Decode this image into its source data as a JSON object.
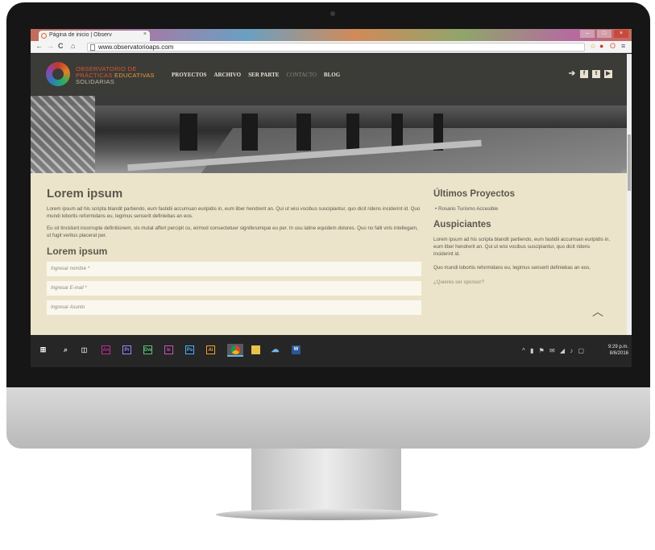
{
  "browser": {
    "tab_title": "Página de inicio | Observ",
    "tab_close": "×",
    "url": "www.observatorioaps.com",
    "back": "←",
    "forward": "→",
    "reload": "C",
    "home": "⌂",
    "star": "☆",
    "menu": "≡"
  },
  "site": {
    "logo": {
      "line1": "OBSERVATORIO DE",
      "line2a": "PRÁCTICAS ",
      "line2b": "EDUCATIVAS",
      "line3": "SOLIDARIAS"
    },
    "nav": [
      "PROYECTOS",
      "ARCHIVO",
      "SER PARTE",
      "CONTACTO",
      "BLOG"
    ],
    "social_icons": [
      "login-icon",
      "facebook-icon",
      "twitter-icon",
      "youtube-icon"
    ],
    "main": {
      "heading": "Lorem ipsum",
      "paragraph1": "Lorem ipsum ad his scripta blandit partiendo, eum fastidii accumsan euripidis in, eum liber hendrerit an. Qui ut wisi vocibus suscipiantur, quo dicit ridens inciderint id. Quo mundi lobortis reformidans eu, legimus senserit definiebas an eos.",
      "paragraph2": "Eu sit tincidunt incorrupte definitionem, vis mutat affert percipit cu, eirmod consectetuer signiferumque eu per. In usu latine equidem dolores. Quo no falli viris intellegam, ut fugit veritus placerat per.",
      "subheading": "Lorem ipsum",
      "placeholders": {
        "name": "Ingresar nombre *",
        "email": "Ingresar E-mail *",
        "subject": "Ingresar Asunto"
      }
    },
    "sidebar": {
      "heading1": "Últimos Proyectos",
      "project": "Rosario Turismo Accesible",
      "heading2": "Auspiciantes",
      "paragraph1": "Lorem ipsum ad his scripta blandit partiendo, eum fastidii accumsan euripidis in, eum liber hendrerit an. Qui ut wisi vocibus suscipiantur, quo dicit ridens inciderint id.",
      "paragraph2": "Quo mundi lobortis reformidans eu, legimus senserit definiebas an eos.",
      "link": "¿Quieres ser sponsor?"
    }
  },
  "taskbar": {
    "apps": [
      {
        "name": "animate-app-icon",
        "label": "An",
        "color": "#c2338a"
      },
      {
        "name": "premiere-app-icon",
        "label": "Pr",
        "color": "#9b8cf0"
      },
      {
        "name": "dreamweaver-app-icon",
        "label": "Dw",
        "color": "#5ec46b"
      },
      {
        "name": "incopy-app-icon",
        "label": "Ic",
        "color": "#d05aa8"
      },
      {
        "name": "photoshop-app-icon",
        "label": "Ps",
        "color": "#4fb6f0"
      },
      {
        "name": "illustrator-app-icon",
        "label": "Ai",
        "color": "#f5a623"
      }
    ],
    "time": "9:29 p.m.",
    "date": "8/6/2016"
  }
}
